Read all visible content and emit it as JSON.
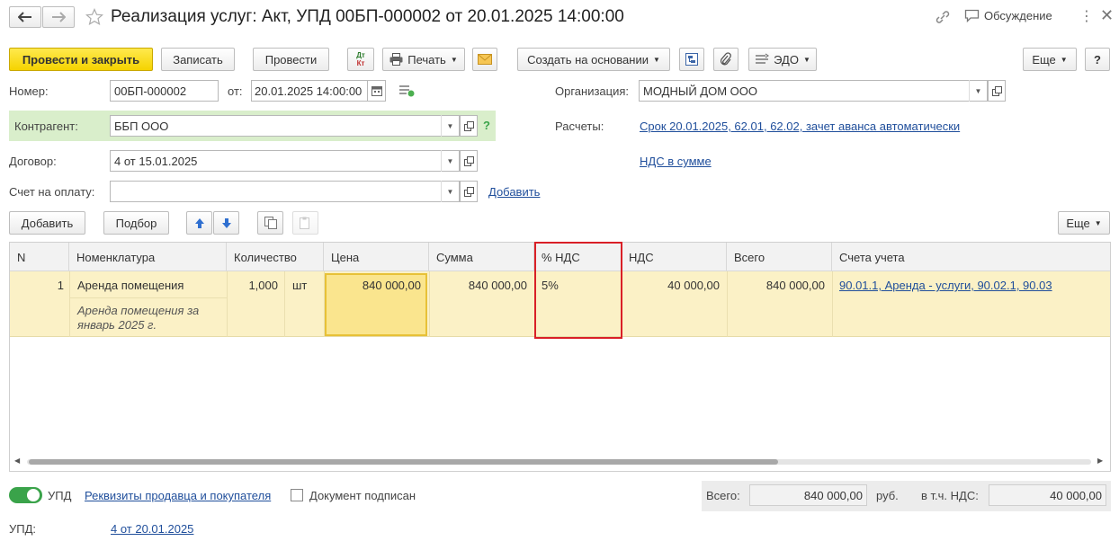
{
  "window": {
    "title": "Реализация услуг: Акт, УПД 00БП-000002 от 20.01.2025 14:00:00",
    "discussion_label": "Обсуждение"
  },
  "toolbar": {
    "post_close": "Провести и закрыть",
    "save": "Записать",
    "post": "Провести",
    "dtkt_top": "Дт",
    "dtkt_bottom": "Кт",
    "print": "Печать",
    "create_based": "Создать на основании",
    "edo": "ЭДО",
    "more": "Еще",
    "help": "?"
  },
  "form": {
    "number_label": "Номер:",
    "number_value": "00БП-000002",
    "from_label": "от:",
    "date_value": "20.01.2025 14:00:00",
    "org_label": "Организация:",
    "org_value": "МОДНЫЙ ДОМ ООО",
    "contractor_label": "Контрагент:",
    "contractor_value": "ББП ООО",
    "contractor_help": "?",
    "settlements_label": "Расчеты:",
    "settlements_link": "Срок 20.01.2025, 62.01, 62.02, зачет аванса автоматически",
    "contract_label": "Договор:",
    "contract_value": "4 от 15.01.2025",
    "vat_link": "НДС в сумме",
    "invoice_label": "Счет на оплату:",
    "invoice_value": "",
    "add_link": "Добавить"
  },
  "table_toolbar": {
    "add": "Добавить",
    "pick": "Подбор",
    "more": "Еще"
  },
  "table": {
    "headers": [
      "N",
      "Номенклатура",
      "Количество",
      "Цена",
      "Сумма",
      "% НДС",
      "НДС",
      "Всего",
      "Счета учета"
    ],
    "rows": [
      {
        "n": "1",
        "item": "Аренда помещения",
        "item_desc_line1": "Аренда помещения за",
        "item_desc_line2": "январь 2025 г.",
        "qty": "1,000",
        "unit": "шт",
        "price": "840 000,00",
        "sum": "840 000,00",
        "vat_rate": "5%",
        "vat": "40 000,00",
        "total": "840 000,00",
        "accounts": "90.01.1, Аренда - услуги, 90.02.1, 90.03"
      }
    ]
  },
  "footer": {
    "upd_toggle_label": "УПД",
    "requisites_link": "Реквизиты продавца и покупателя",
    "signed_label": "Документ подписан",
    "total_label": "Всего:",
    "total_value": "840 000,00",
    "currency": "руб.",
    "vat_incl_label": "в т.ч. НДС:",
    "vat_incl_value": "40 000,00",
    "upd_label": "УПД:",
    "upd_link": "4 от 20.01.2025"
  },
  "colors": {
    "accent_yellow": "#f5d300",
    "row_highlight": "#fbf1c6",
    "selected_cell": "#fae58e",
    "contractor_bg": "#d9eecb",
    "link": "#1f4e9b",
    "callout_red": "#d92027",
    "toggle_green": "#3aa34a"
  }
}
